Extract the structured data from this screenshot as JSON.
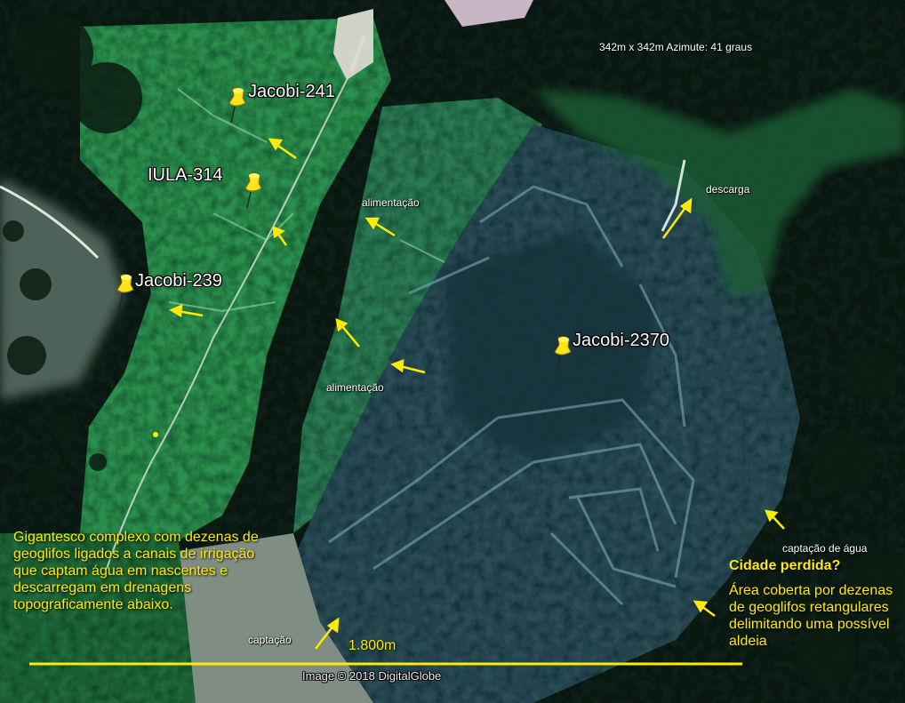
{
  "header": {
    "tile_info": "342m x 342m Azimute: 41 graus"
  },
  "placemarks": [
    {
      "label": "Jacobi-241"
    },
    {
      "label": "IULA-314"
    },
    {
      "label": "Jacobi-239"
    },
    {
      "label": "Jacobi-2370"
    }
  ],
  "annotations": {
    "descarga": "descarga",
    "alimentacao_1": "alimentação",
    "alimentacao_2": "alimentação",
    "captacao_agua": "captação de água",
    "captacao": "captação"
  },
  "left_text": "Gigantesco complexo com dezenas de geoglifos ligados a canais de irrigação que captam água em nascentes e descarregam em drenagens topograficamente abaixo.",
  "right_box": {
    "title": "Cidade perdida?",
    "body": "Área coberta por dezenas de geoglifos retangulares delimitando uma possível aldeia"
  },
  "scale_bar": {
    "label": "1.800m"
  },
  "credit": "Image © 2018 DigitalGlobe",
  "colors": {
    "annotation_yellow": "#ffea00",
    "pin_yellow": "#ffe41a"
  }
}
